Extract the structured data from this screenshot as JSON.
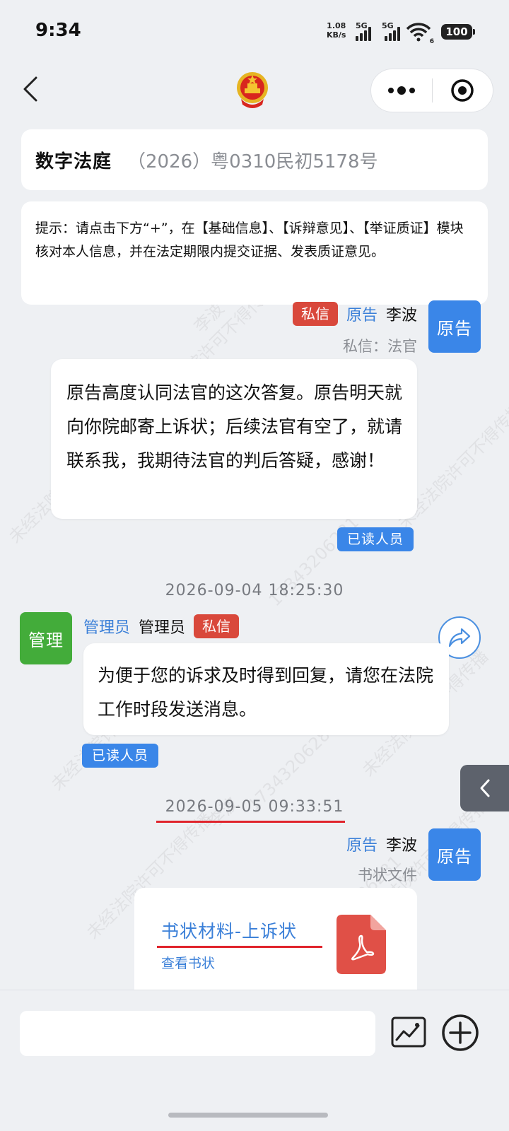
{
  "status_bar": {
    "time": "9:34",
    "net_speed_value": "1.08",
    "net_speed_unit": "KB/s",
    "sim1": "5G",
    "sim2": "5G",
    "wifi_sub": "6",
    "battery": "100"
  },
  "nav": {
    "back_icon": "chevron-left-icon",
    "center_icon": "national-emblem-icon",
    "more_icon": "more-dots-icon",
    "record_icon": "target-icon"
  },
  "header": {
    "app_title": "数字法庭",
    "case_number": "（2026）粤0310民初5178号"
  },
  "hint": {
    "text": "提示：请点击下方“+”，在【基础信息】、【诉辩意见】、【举证质证】模块核对本人信息，并在法定期限内提交证据、发表质证意见。"
  },
  "messages": [
    {
      "tag": "私信",
      "role": "原告",
      "name": "李波",
      "sub": "私信：法官",
      "avatar": "原告",
      "text": "原告高度认同法官的这次答复。原告明天就向你院邮寄上诉状；后续法官有空了，就请联系我，我期待法官的判后答疑，感谢！",
      "read_label": "已读人员"
    },
    {
      "timestamp": "2026-09-04 18:25:30",
      "role": "管理员",
      "name": "管理员",
      "tag": "私信",
      "avatar": "管理",
      "text": "为便于您的诉求及时得到回复，请您在法院工作时段发送消息。",
      "read_label": "已读人员"
    },
    {
      "timestamp": "2026-09-05 09:33:51",
      "role": "原告",
      "name": "李波",
      "sub": "书状文件",
      "avatar": "原告",
      "file_title": "书状材料-上诉状",
      "file_action": "查看书状"
    }
  ],
  "watermark": {
    "text1": "未经法院许可不得传播",
    "text2": "李波",
    "text3": "17343206281"
  },
  "input": {
    "placeholder": "",
    "image_icon": "image-icon",
    "plus_icon": "plus-circle-icon"
  },
  "colors": {
    "accent_blue": "#3a86e8",
    "private_red": "#d9483b",
    "admin_green": "#43ac3a",
    "pdf_red": "#e05047",
    "highlight_line": "#e0242c"
  }
}
